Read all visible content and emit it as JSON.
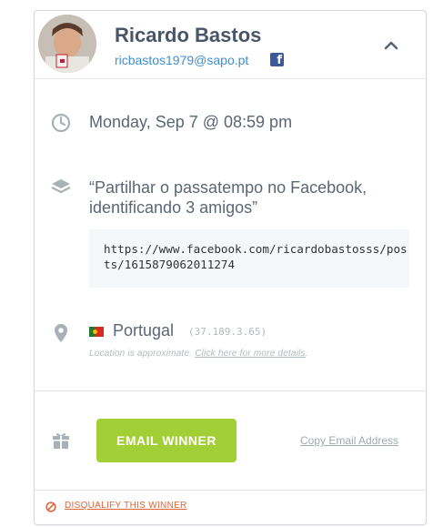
{
  "header": {
    "name": "Ricardo Bastos",
    "email": "ricbastos1979@sapo.pt",
    "social_network": "Facebook"
  },
  "entry": {
    "datetime": "Monday, Sep 7 @ 08:59 pm",
    "action": "“Partilhar o passatempo no Facebook, identificando 3 amigos”",
    "url": "https://www.facebook.com/ricardobastosss/posts/1615879062011274"
  },
  "location": {
    "country": "Portugal",
    "ip": "(37.189.3.65)",
    "note_prefix": "Location is approximate.",
    "note_link": "Click here for more details",
    "note_suffix": "."
  },
  "actions": {
    "email_winner": "EMAIL WINNER",
    "copy_email": "Copy Email Address",
    "disqualify": "DISQUALIFY THIS WINNER"
  },
  "colors": {
    "accent_green": "#a3cf36",
    "link_blue": "#3f8fd0",
    "danger": "#e0643a"
  }
}
